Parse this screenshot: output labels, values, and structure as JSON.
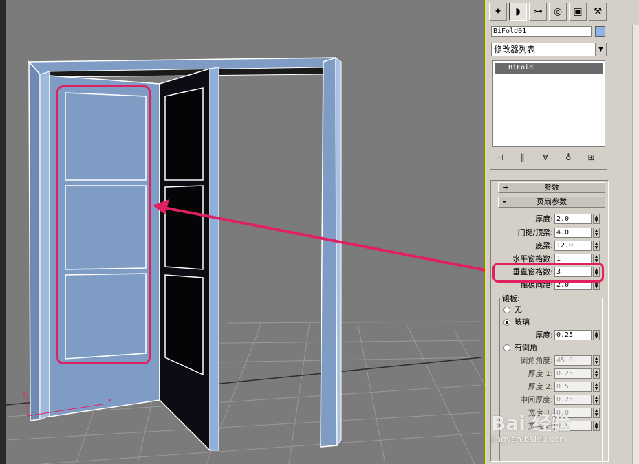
{
  "panel": {
    "object_name": "BiFold01",
    "object_color": "#8fb5e6",
    "modifier_list": "修改器列表",
    "stack_item": "BiFold",
    "tabs": [
      "create-icon",
      "modify-icon",
      "hierarchy-icon",
      "motion-icon",
      "display-icon",
      "utilities-icon"
    ]
  },
  "rollouts": {
    "params_title": "参数",
    "leaf_params_title": "页扇参数",
    "params_sign": "+",
    "leaf_sign": "-"
  },
  "leaf_params": {
    "thickness_label": "厚度:",
    "thickness": "2.0",
    "stile_label": "门挺/顶梁:",
    "stile": "4.0",
    "bottom_rail_label": "底梁:",
    "bottom_rail": "12.0",
    "h_panels_label": "水平窗格数:",
    "h_panels": "1",
    "v_panels_label": "垂直窗格数:",
    "v_panels": "3",
    "muntin_label": "镶板间距:",
    "muntin": "2.0"
  },
  "panels_group": {
    "title": "镶板:",
    "none_label": "无",
    "glass_label": "玻璃",
    "glass_thickness_label": "厚度:",
    "glass_thickness": "0.25",
    "beveled_label": "有倒角",
    "bevel_angle_label": "倒角角度:",
    "bevel_angle": "45.0",
    "thick1_label": "厚度 1:",
    "thick1": "0.25",
    "thick2_label": "厚度 2:",
    "thick2": "0.5",
    "middle_thick_label": "中间厚度:",
    "middle_thick": "0.25",
    "width1_label": "宽度 1:",
    "width1": "0.0",
    "width2_label": "宽度 2:",
    "width2": "0.5"
  },
  "watermark": {
    "logo": "Bai 经验",
    "url": "jingyan.baidu.com"
  },
  "colors": {
    "highlight": "#e0205f",
    "viewport_bg": "#7b7b7b",
    "door": "#7f9dc4"
  }
}
